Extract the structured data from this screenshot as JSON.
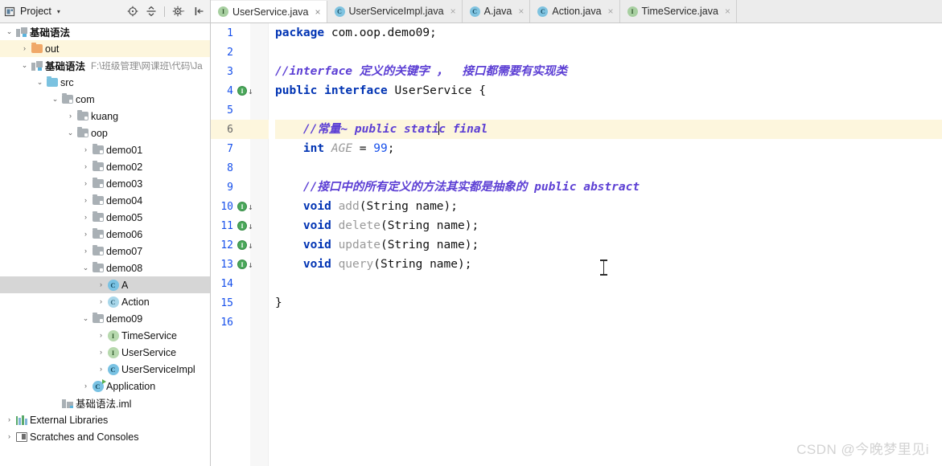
{
  "project_panel": {
    "title": "Project",
    "caret": "▾",
    "icons": [
      {
        "name": "project-view-icon",
        "glyph": "project"
      },
      {
        "name": "locate-icon",
        "glyph": "locate"
      },
      {
        "name": "collapse-all-icon",
        "glyph": "collapse"
      },
      {
        "name": "settings-gear-icon",
        "glyph": "gear"
      },
      {
        "name": "hide-panel-icon",
        "glyph": "hide"
      }
    ]
  },
  "tabs": [
    {
      "label": "UserService.java",
      "icon": "interface-icon",
      "icon_letter": "I",
      "kind": "iface",
      "active": true,
      "close": "×"
    },
    {
      "label": "UserServiceImpl.java",
      "icon": "class-icon",
      "icon_letter": "C",
      "kind": "cls",
      "active": false,
      "close": "×"
    },
    {
      "label": "A.java",
      "icon": "class-icon",
      "icon_letter": "C",
      "kind": "cls",
      "active": false,
      "close": "×"
    },
    {
      "label": "Action.java",
      "icon": "class-icon",
      "icon_letter": "C",
      "kind": "cls",
      "active": false,
      "close": "×"
    },
    {
      "label": "TimeService.java",
      "icon": "interface-icon",
      "icon_letter": "I",
      "kind": "iface",
      "active": false,
      "close": "×"
    }
  ],
  "tree": [
    {
      "label": "基础语法",
      "indent": 0,
      "arrow": "⌄",
      "icon": "module-icon",
      "bold": true,
      "state": "normal"
    },
    {
      "label": "out",
      "indent": 1,
      "arrow": "›",
      "icon": "folder-orange-icon",
      "bold": false,
      "state": "highlight"
    },
    {
      "label": "基础语法",
      "indent": 1,
      "arrow": "⌄",
      "icon": "module-icon",
      "bold": true,
      "state": "normal",
      "path": "F:\\班级管理\\网课班\\代码\\Ja"
    },
    {
      "label": "src",
      "indent": 2,
      "arrow": "⌄",
      "icon": "source-folder-icon",
      "bold": false,
      "state": "normal"
    },
    {
      "label": "com",
      "indent": 3,
      "arrow": "⌄",
      "icon": "package-icon",
      "bold": false,
      "state": "normal"
    },
    {
      "label": "kuang",
      "indent": 4,
      "arrow": "›",
      "icon": "package-icon",
      "bold": false,
      "state": "normal"
    },
    {
      "label": "oop",
      "indent": 4,
      "arrow": "⌄",
      "icon": "package-icon",
      "bold": false,
      "state": "normal"
    },
    {
      "label": "demo01",
      "indent": 5,
      "arrow": "›",
      "icon": "package-icon",
      "bold": false,
      "state": "normal"
    },
    {
      "label": "demo02",
      "indent": 5,
      "arrow": "›",
      "icon": "package-icon",
      "bold": false,
      "state": "normal"
    },
    {
      "label": "demo03",
      "indent": 5,
      "arrow": "›",
      "icon": "package-icon",
      "bold": false,
      "state": "normal"
    },
    {
      "label": "demo04",
      "indent": 5,
      "arrow": "›",
      "icon": "package-icon",
      "bold": false,
      "state": "normal"
    },
    {
      "label": "demo05",
      "indent": 5,
      "arrow": "›",
      "icon": "package-icon",
      "bold": false,
      "state": "normal"
    },
    {
      "label": "demo06",
      "indent": 5,
      "arrow": "›",
      "icon": "package-icon",
      "bold": false,
      "state": "normal"
    },
    {
      "label": "demo07",
      "indent": 5,
      "arrow": "›",
      "icon": "package-icon",
      "bold": false,
      "state": "normal"
    },
    {
      "label": "demo08",
      "indent": 5,
      "arrow": "⌄",
      "icon": "package-icon",
      "bold": false,
      "state": "normal"
    },
    {
      "label": "A",
      "indent": 6,
      "arrow": "›",
      "icon": "class-icon",
      "icon_letter": "C",
      "bold": false,
      "state": "selected"
    },
    {
      "label": "Action",
      "indent": 6,
      "arrow": "›",
      "icon": "class-icon",
      "icon_letter": "C",
      "bold": false,
      "state": "normal"
    },
    {
      "label": "demo09",
      "indent": 5,
      "arrow": "⌄",
      "icon": "package-icon",
      "bold": false,
      "state": "normal"
    },
    {
      "label": "TimeService",
      "indent": 6,
      "arrow": "›",
      "icon": "interface-icon",
      "icon_letter": "I",
      "bold": false,
      "state": "normal"
    },
    {
      "label": "UserService",
      "indent": 6,
      "arrow": "›",
      "icon": "interface-icon",
      "icon_letter": "I",
      "bold": false,
      "state": "normal"
    },
    {
      "label": "UserServiceImpl",
      "indent": 6,
      "arrow": "›",
      "icon": "class-icon",
      "icon_letter": "C",
      "bold": false,
      "state": "normal"
    },
    {
      "label": "Application",
      "indent": 5,
      "arrow": "›",
      "icon": "runnable-class-icon",
      "icon_letter": "C",
      "bold": false,
      "state": "normal"
    },
    {
      "label": "基础语法.iml",
      "indent": 3,
      "arrow": "",
      "icon": "iml-file-icon",
      "bold": false,
      "state": "normal"
    },
    {
      "label": "External Libraries",
      "indent": 0,
      "arrow": "›",
      "icon": "libraries-icon",
      "bold": false,
      "state": "normal"
    },
    {
      "label": "Scratches and Consoles",
      "indent": 0,
      "arrow": "›",
      "icon": "scratches-icon",
      "bold": false,
      "state": "normal"
    }
  ],
  "editor": {
    "lines": [
      {
        "n": "1",
        "current": false,
        "marker": null
      },
      {
        "n": "2",
        "current": false,
        "marker": null
      },
      {
        "n": "3",
        "current": false,
        "marker": null
      },
      {
        "n": "4",
        "current": false,
        "marker": "implemented"
      },
      {
        "n": "5",
        "current": false,
        "marker": null
      },
      {
        "n": "6",
        "current": true,
        "marker": null
      },
      {
        "n": "7",
        "current": false,
        "marker": null
      },
      {
        "n": "8",
        "current": false,
        "marker": null
      },
      {
        "n": "9",
        "current": false,
        "marker": null
      },
      {
        "n": "10",
        "current": false,
        "marker": "implemented"
      },
      {
        "n": "11",
        "current": false,
        "marker": "implemented"
      },
      {
        "n": "12",
        "current": false,
        "marker": "implemented"
      },
      {
        "n": "13",
        "current": false,
        "marker": "implemented"
      },
      {
        "n": "14",
        "current": false,
        "marker": null
      },
      {
        "n": "15",
        "current": false,
        "marker": null
      },
      {
        "n": "16",
        "current": false,
        "marker": null
      }
    ],
    "code": {
      "l1_kw_package": "package",
      "l1_name": " com.oop.demo09;",
      "l3_comment": "//interface 定义的关键字 ，  接口都需要有实现类",
      "l4_kw_public": "public",
      "l4_kw_interface": "interface",
      "l4_name": "UserService",
      "l4_brace": "{",
      "l6_comment_a": "//常量~ public stati",
      "l6_comment_b": "c final",
      "l7_kw_int": "int",
      "l7_field": "AGE",
      "l7_eq": "= ",
      "l7_value": "99",
      "l7_semi": ";",
      "l9_comment": "//接口中的所有定义的方法其实都是抽象的 public abstract",
      "l10_kw": "void",
      "l10_method": "add",
      "l10_args": "(String name);",
      "l11_kw": "void",
      "l11_method": "delete",
      "l11_args": "(String name);",
      "l12_kw": "void",
      "l12_method": "update",
      "l12_args": "(String name);",
      "l13_kw": "void",
      "l13_method": "query",
      "l13_args": "(String name);",
      "l15_brace": "}"
    }
  },
  "watermark": "CSDN @今晚梦里见i"
}
